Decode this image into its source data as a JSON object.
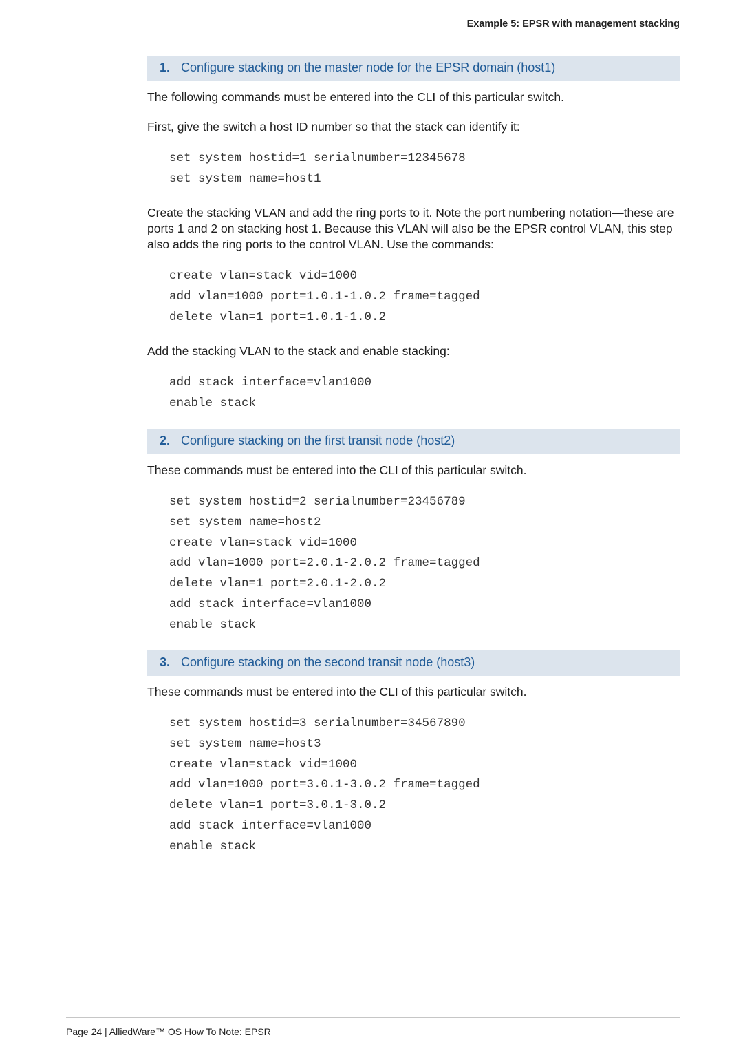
{
  "running_head": "Example 5: EPSR with management stacking",
  "step1": {
    "num": "1.",
    "title": "Configure stacking on the master node for the EPSR domain (host1)"
  },
  "p1": "The following commands must be entered into the CLI of this particular switch.",
  "p2": "First, give the switch a host ID number so that the stack can identify it:",
  "code1": [
    "set system hostid=1 serialnumber=12345678",
    "set system name=host1"
  ],
  "p3": "Create the stacking VLAN and add the ring ports to it. Note the port numbering notation—these are ports 1 and 2 on stacking host 1. Because this VLAN will also be the EPSR control VLAN, this step also adds the ring ports to the control VLAN. Use the commands:",
  "code2": [
    "create vlan=stack vid=1000",
    "add vlan=1000 port=1.0.1-1.0.2 frame=tagged",
    "delete vlan=1 port=1.0.1-1.0.2"
  ],
  "p4": "Add the stacking VLAN to the stack and enable stacking:",
  "code3": [
    "add stack interface=vlan1000",
    "enable stack"
  ],
  "step2": {
    "num": "2.",
    "title": "Configure stacking on the first transit node (host2)"
  },
  "p5": "These commands must be entered into the CLI of this particular switch.",
  "code4": [
    "set system hostid=2 serialnumber=23456789",
    "set system name=host2",
    "create vlan=stack vid=1000",
    "add vlan=1000 port=2.0.1-2.0.2 frame=tagged",
    "delete vlan=1 port=2.0.1-2.0.2",
    "add stack interface=vlan1000",
    "enable stack"
  ],
  "step3": {
    "num": "3.",
    "title": "Configure stacking on the second transit node (host3)"
  },
  "p6": "These commands must be entered into the CLI of this particular switch.",
  "code5": [
    "set system hostid=3 serialnumber=34567890",
    "set system name=host3",
    "create vlan=stack vid=1000",
    "add vlan=1000 port=3.0.1-3.0.2 frame=tagged",
    "delete vlan=1 port=3.0.1-3.0.2",
    "add stack interface=vlan1000",
    "enable stack"
  ],
  "footer": "Page 24 | AlliedWare™ OS How To Note: EPSR"
}
